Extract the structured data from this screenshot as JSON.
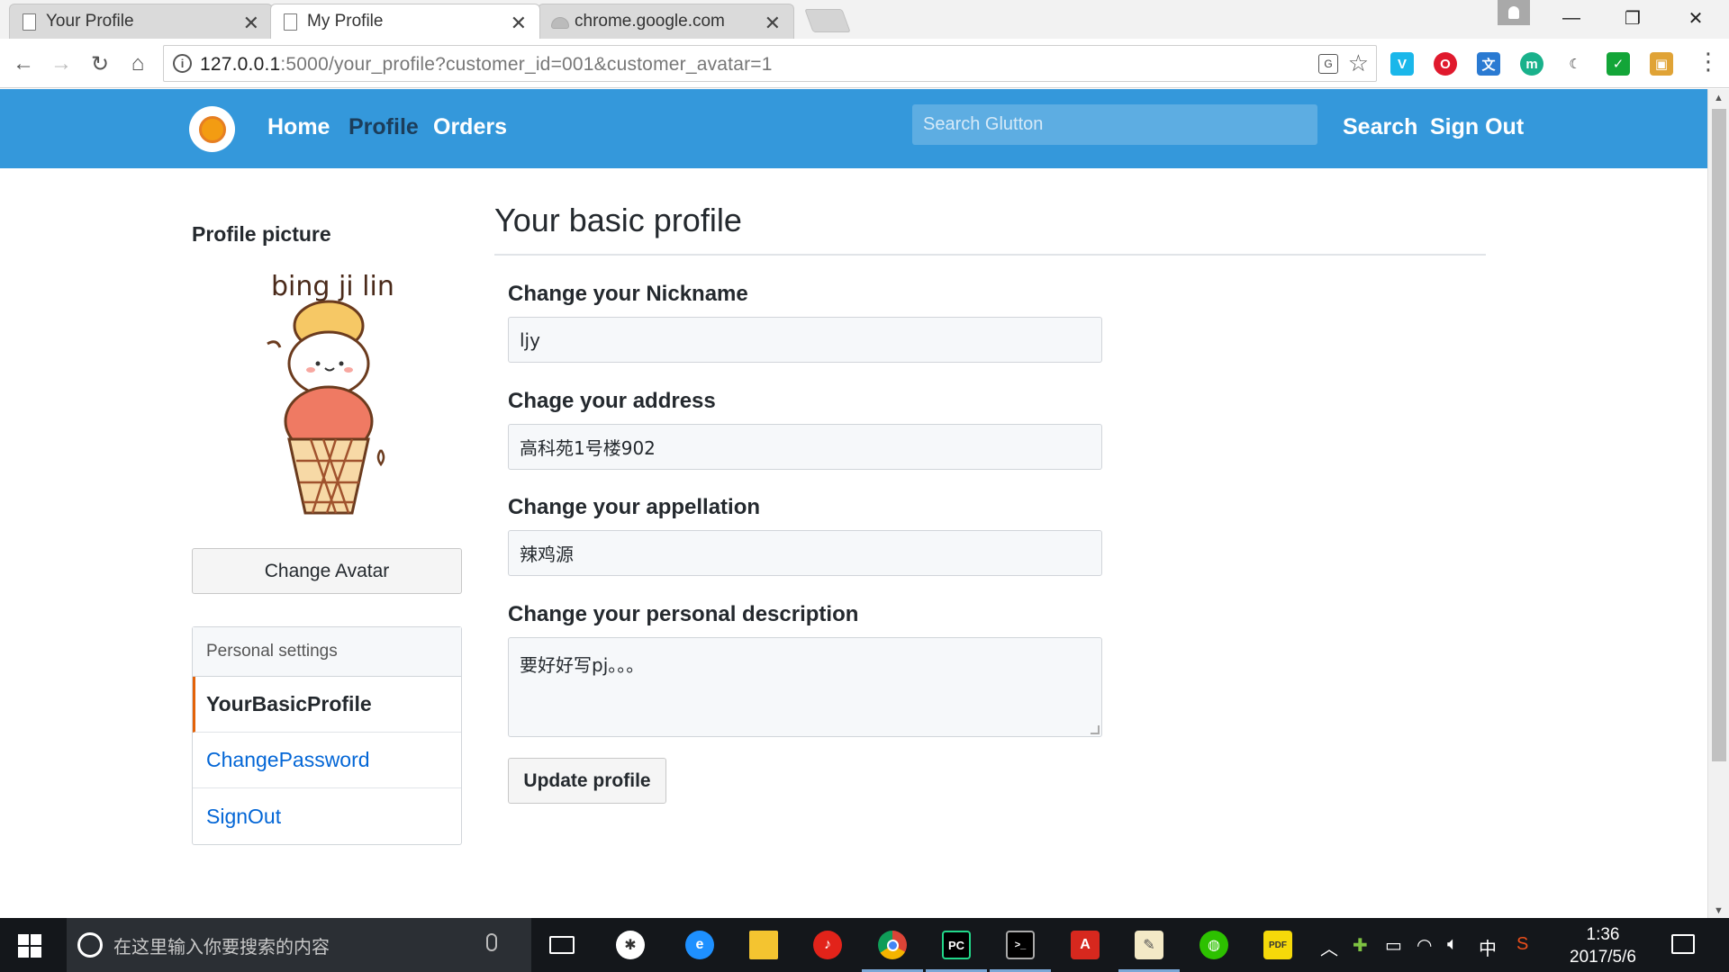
{
  "browser": {
    "tabs": [
      {
        "title": "Your Profile",
        "active": false,
        "icon": "page-icon"
      },
      {
        "title": "My Profile",
        "active": true,
        "icon": "page-icon"
      },
      {
        "title": "chrome.google.com",
        "active": false,
        "icon": "cloud-icon"
      }
    ],
    "url_host": "127.0.0.1",
    "url_rest": ":5000/your_profile?customer_id=001&customer_avatar=1",
    "extensions": [
      {
        "name": "vimeo-extension-icon",
        "color": "#1ab7ea",
        "glyph": "V"
      },
      {
        "name": "opera-extension-icon",
        "color": "#e0192d",
        "glyph": "O"
      },
      {
        "name": "translate-extension-icon",
        "color": "#2a7ad2",
        "glyph": "文"
      },
      {
        "name": "mercury-extension-icon",
        "color": "#19b18b",
        "glyph": "m"
      },
      {
        "name": "moon-extension-icon",
        "color": "#ffffff",
        "glyph": "☾"
      },
      {
        "name": "shield-extension-icon",
        "color": "#13a538",
        "glyph": "✓"
      },
      {
        "name": "bag-extension-icon",
        "color": "#e0a336",
        "glyph": "▣"
      }
    ]
  },
  "navbar": {
    "links": [
      "Home",
      "Profile",
      "Orders"
    ],
    "active": "Profile",
    "search_placeholder": "Search Glutton",
    "search_label": "Search",
    "signout_label": "Sign Out",
    "color": "#3498db"
  },
  "sidebar": {
    "title": "Profile picture",
    "avatar_text": "bing ji lin",
    "change_avatar_label": "Change Avatar",
    "settings_header": "Personal settings",
    "items": [
      {
        "label": "YourBasicProfile",
        "selected": true
      },
      {
        "label": "ChangePassword",
        "selected": false
      },
      {
        "label": "SignOut",
        "selected": false
      }
    ]
  },
  "form": {
    "heading": "Your basic profile",
    "nickname_label": "Change your Nickname",
    "nickname_value": "ljy",
    "address_label": "Chage your address",
    "address_value": "高科苑1号楼902",
    "appellation_label": "Change your appellation",
    "appellation_value": "辣鸡源",
    "description_label": "Change your personal description",
    "description_value": "要好好写pj。。。",
    "update_label": "Update profile"
  },
  "taskbar": {
    "search_placeholder": "在这里输入你要搜索的内容",
    "time": "1:36",
    "date": "2017/5/6",
    "ime": "中"
  }
}
